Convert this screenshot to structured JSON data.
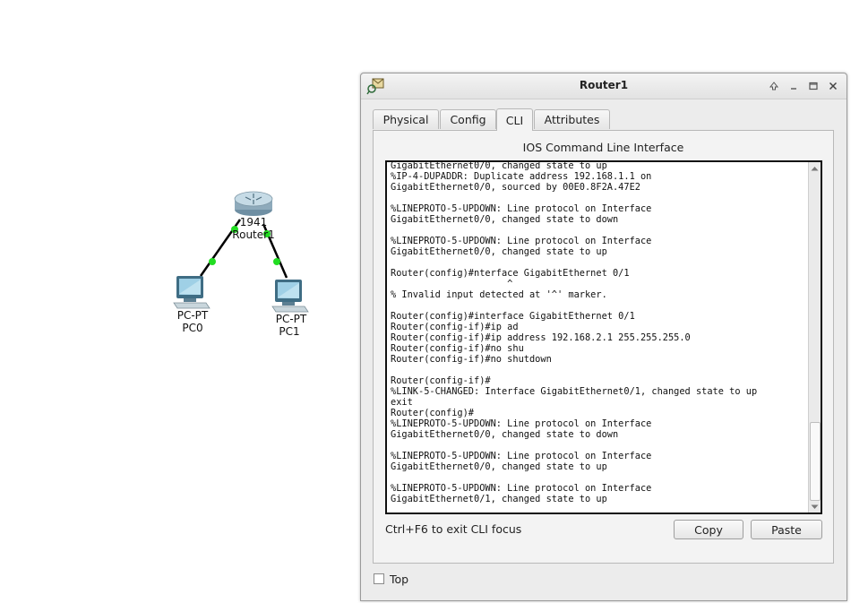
{
  "topology": {
    "router": {
      "model": "1941",
      "name": "Router1"
    },
    "pc0": {
      "type": "PC-PT",
      "name": "PC0"
    },
    "pc1": {
      "type": "PC-PT",
      "name": "PC1"
    },
    "link_light_color": "#22dd22"
  },
  "window": {
    "title": "Router1",
    "tabs": [
      {
        "label": "Physical",
        "active": false
      },
      {
        "label": "Config",
        "active": false
      },
      {
        "label": "CLI",
        "active": true
      },
      {
        "label": "Attributes",
        "active": false
      }
    ],
    "panel_title": "IOS Command Line Interface",
    "cli_lines": [
      "GigabitEthernet0/0, changed state to up",
      "%IP-4-DUPADDR: Duplicate address 192.168.1.1 on",
      "GigabitEthernet0/0, sourced by 00E0.8F2A.47E2",
      "",
      "%LINEPROTO-5-UPDOWN: Line protocol on Interface",
      "GigabitEthernet0/0, changed state to down",
      "",
      "%LINEPROTO-5-UPDOWN: Line protocol on Interface",
      "GigabitEthernet0/0, changed state to up",
      "",
      "Router(config)#nterface GigabitEthernet 0/1",
      "                     ^",
      "% Invalid input detected at '^' marker.",
      "",
      "Router(config)#interface GigabitEthernet 0/1",
      "Router(config-if)#ip ad",
      "Router(config-if)#ip address 192.168.2.1 255.255.255.0",
      "Router(config-if)#no shu",
      "Router(config-if)#no shutdown",
      "",
      "Router(config-if)#",
      "%LINK-5-CHANGED: Interface GigabitEthernet0/1, changed state to up",
      "exit",
      "Router(config)#",
      "%LINEPROTO-5-UPDOWN: Line protocol on Interface",
      "GigabitEthernet0/0, changed state to down",
      "",
      "%LINEPROTO-5-UPDOWN: Line protocol on Interface",
      "GigabitEthernet0/0, changed state to up",
      "",
      "%LINEPROTO-5-UPDOWN: Line protocol on Interface",
      "GigabitEthernet0/1, changed state to up"
    ],
    "exit_hint": "Ctrl+F6 to exit CLI focus",
    "copy_label": "Copy",
    "paste_label": "Paste",
    "top_label": "Top",
    "top_checked": false
  }
}
